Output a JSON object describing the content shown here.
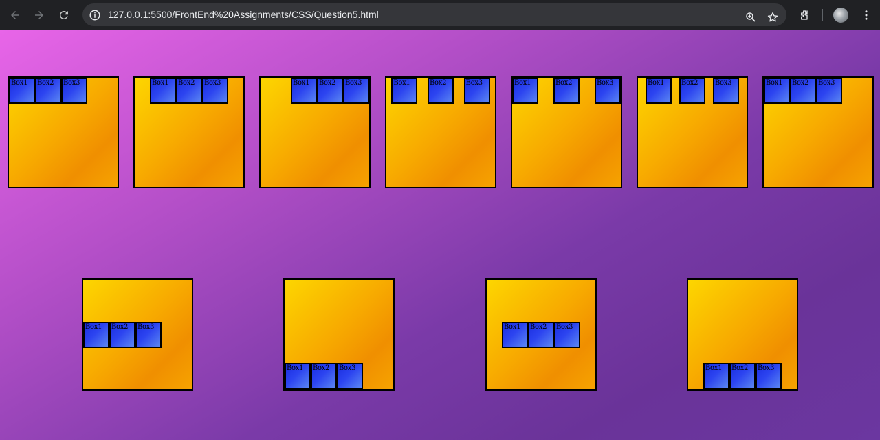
{
  "browser": {
    "url": "127.0.0.1:5500/FrontEnd%20Assignments/CSS/Question5.html",
    "icons": [
      "back-arrow-icon",
      "forward-arrow-icon",
      "reload-icon",
      "site-info-icon",
      "zoom-icon",
      "star-icon",
      "extensions-icon",
      "profile-avatar",
      "kebab-menu-icon"
    ]
  },
  "page": {
    "box_labels": [
      "Box1",
      "Box2",
      "Box3"
    ],
    "colors": {
      "background_start": "#e865e8",
      "background_end": "#6a3399",
      "container_start": "#fdd600",
      "container_end": "#f08f00",
      "box_start": "#1a2ee0",
      "box_end": "#5b86f2"
    }
  }
}
